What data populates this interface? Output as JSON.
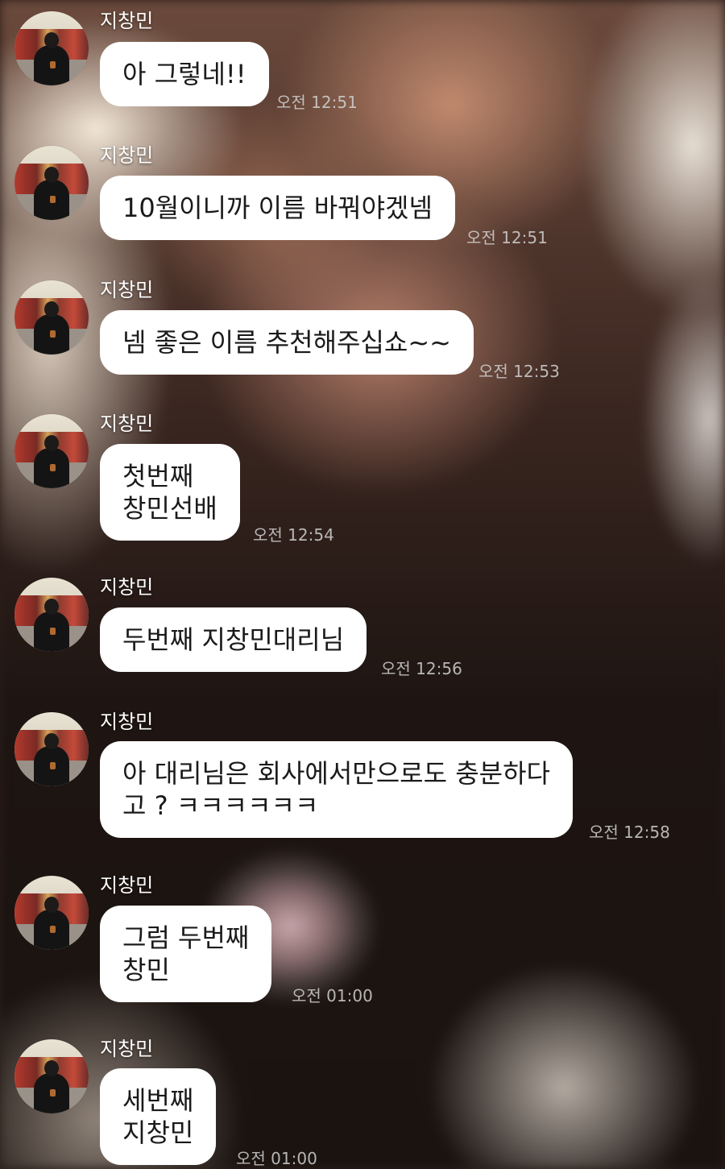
{
  "messages": [
    {
      "sender": "지창민",
      "text": "아 그렇네!!",
      "time": "오전 12:51"
    },
    {
      "sender": "지창민",
      "text": "10월이니까 이름 바꿔야겠넴",
      "time": "오전 12:51"
    },
    {
      "sender": "지창민",
      "text": "넴 좋은 이름 추천해주십쇼~~",
      "time": "오전 12:53"
    },
    {
      "sender": "지창민",
      "text": "첫번째\n창민선배",
      "time": "오전 12:54"
    },
    {
      "sender": "지창민",
      "text": "두번째 지창민대리님",
      "time": "오전 12:56"
    },
    {
      "sender": "지창민",
      "text": "아 대리님은 회사에서만으로도 충분하다\n고 ? ㅋㅋㅋㅋㅋㅋ",
      "time": "오전 12:58"
    },
    {
      "sender": "지창민",
      "text": "그럼 두번째\n창민",
      "time": "오전 01:00"
    },
    {
      "sender": "지창민",
      "text": "세번째\n지창민",
      "time": "오전 01:00"
    }
  ]
}
